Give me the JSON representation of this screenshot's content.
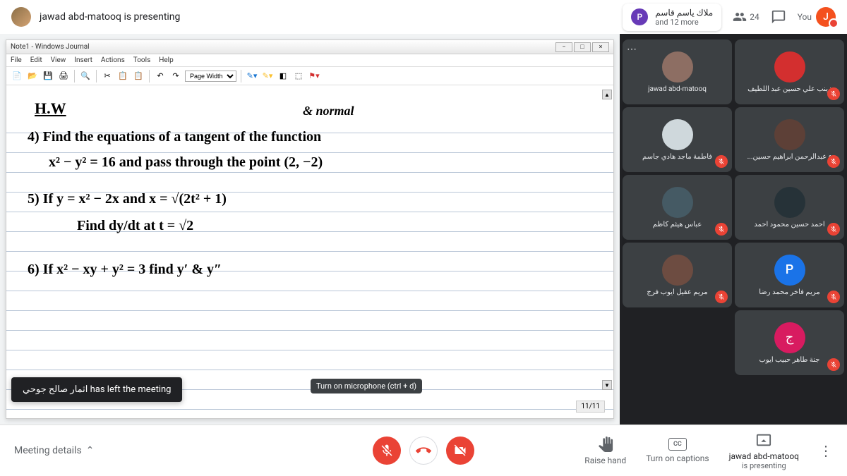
{
  "header": {
    "presenter_text": "jawad abd-matooq is presenting",
    "chip_name": "ملاك ياسم قاسم",
    "chip_more": "and 12 more",
    "count": "24",
    "you_label": "You",
    "you_initial": "J",
    "chip_initial": "P"
  },
  "journal": {
    "title": "Note1 - Windows Journal",
    "menu": [
      "File",
      "Edit",
      "View",
      "Insert",
      "Actions",
      "Tools",
      "Help"
    ],
    "zoom": "Page Width",
    "page": "11/11"
  },
  "handwriting": {
    "title": "H.W",
    "normal": "& normal",
    "l1": "4) Find the equations of a tangent of the function",
    "l2": "x² − y² = 16  and pass through the point (2, −2)",
    "l3": "5) If  y = x² − 2x   and  x = √(2t² + 1)",
    "l4": "Find  dy/dt   at  t = √2",
    "l5": "6) If  x² − xy + y² = 3     find  y′  &  y″"
  },
  "toast": "اثمار صالح جوحي has left the meeting",
  "tooltip": "Turn on microphone (ctrl + d)",
  "participants": [
    [
      {
        "name": "jawad abd-matooq",
        "muted": false,
        "dots": true,
        "color": "#8d6e63"
      },
      {
        "name": "زينب علي حسين عبد اللطيف",
        "muted": true,
        "color": "#d32f2f"
      }
    ],
    [
      {
        "name": "فاطمة ماجد هادي جاسم",
        "muted": true,
        "color": "#cfd8dc"
      },
      {
        "name": "...ء عبدالرحمن ابراهيم حسين",
        "muted": true,
        "color": "#5d4037"
      }
    ],
    [
      {
        "name": "عباس هيثم كاظم",
        "muted": true,
        "color": "#455a64"
      },
      {
        "name": "احمد حسين محمود احمد",
        "muted": true,
        "color": "#263238"
      }
    ],
    [
      {
        "name": "مريم عقيل ايوب فرج",
        "muted": true,
        "color": "#6d4c41"
      },
      {
        "name": "مريم فاخر محمد رضا",
        "muted": true,
        "initial": "P",
        "letter": true,
        "color": "#1a73e8"
      }
    ],
    [
      {
        "spacer": true
      },
      {
        "name": "جنة طاهر حبيب ايوب",
        "muted": true,
        "initial": "ج",
        "letter": true,
        "color": "#d81b60"
      }
    ]
  ],
  "bottom": {
    "meeting_details": "Meeting details",
    "raise_hand": "Raise hand",
    "captions": "Turn on captions",
    "presenting_name": "jawad abd-matooq",
    "presenting_sub": "is presenting",
    "cc": "CC"
  }
}
